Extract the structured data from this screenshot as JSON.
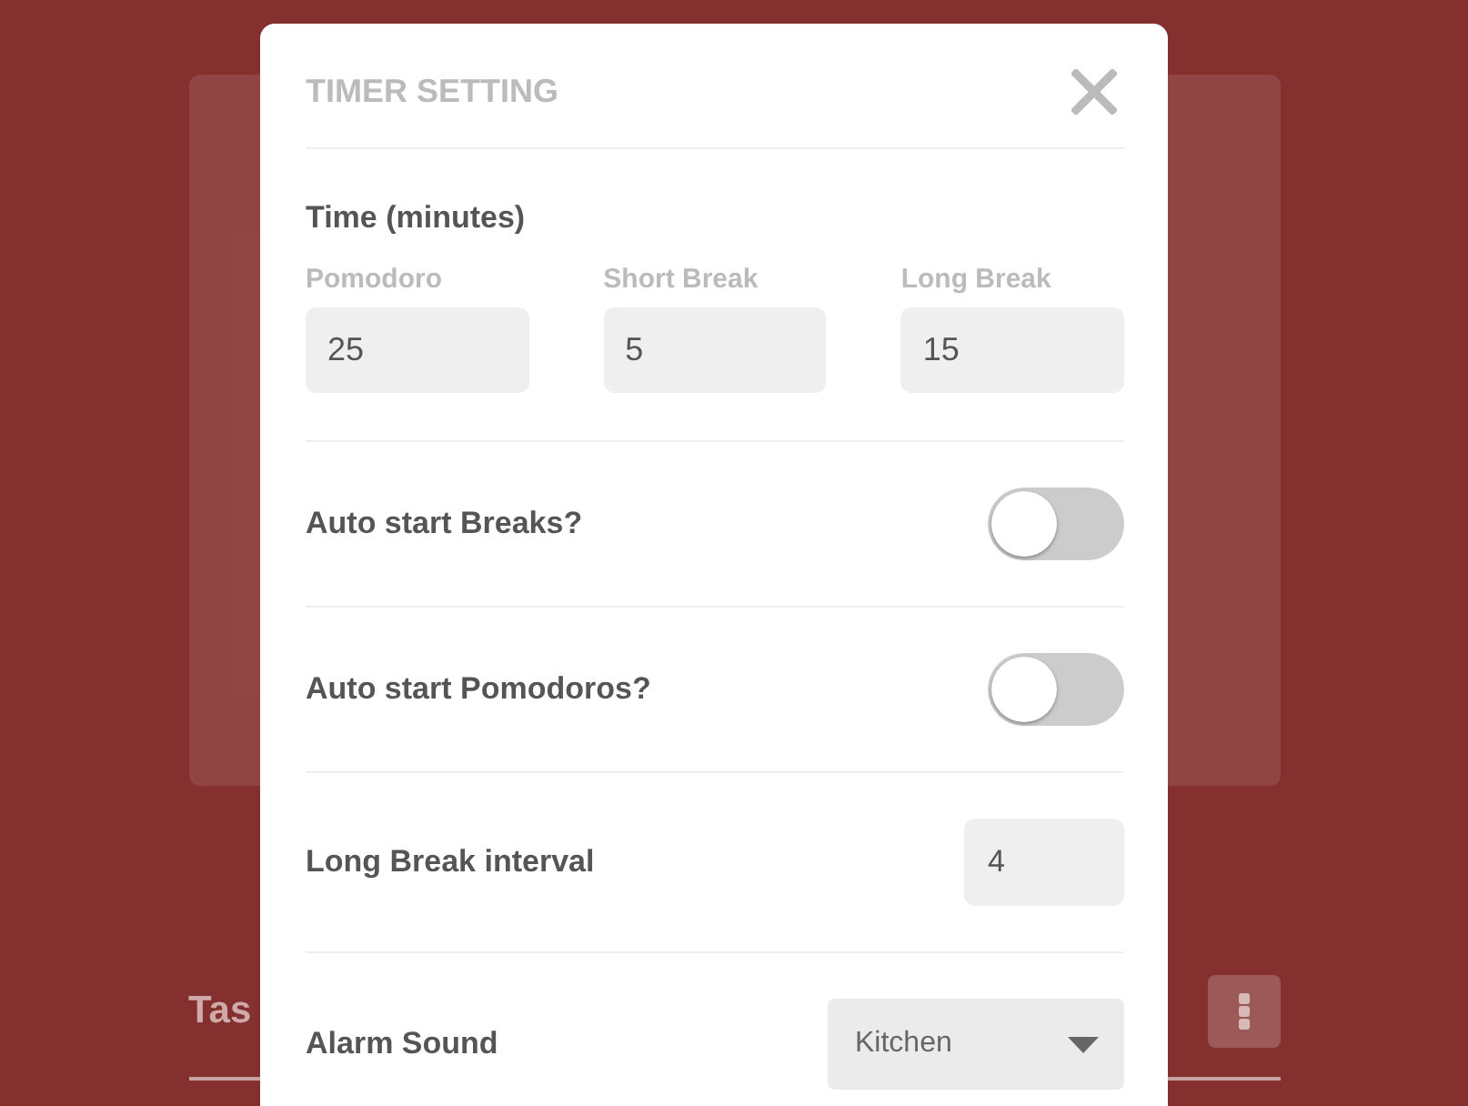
{
  "background": {
    "section_heading": "Tas"
  },
  "modal": {
    "title": "TIMER SETTING",
    "time_section": {
      "heading": "Time (minutes)",
      "fields": [
        {
          "label": "Pomodoro",
          "value": "25"
        },
        {
          "label": "Short Break",
          "value": "5"
        },
        {
          "label": "Long Break",
          "value": "15"
        }
      ]
    },
    "settings": [
      {
        "kind": "toggle",
        "label": "Auto start Breaks?",
        "on": false
      },
      {
        "kind": "toggle",
        "label": "Auto start Pomodoros?",
        "on": false
      },
      {
        "kind": "number",
        "label": "Long Break interval",
        "value": "4"
      },
      {
        "kind": "select",
        "label": "Alarm Sound",
        "value": "Kitchen"
      }
    ]
  }
}
